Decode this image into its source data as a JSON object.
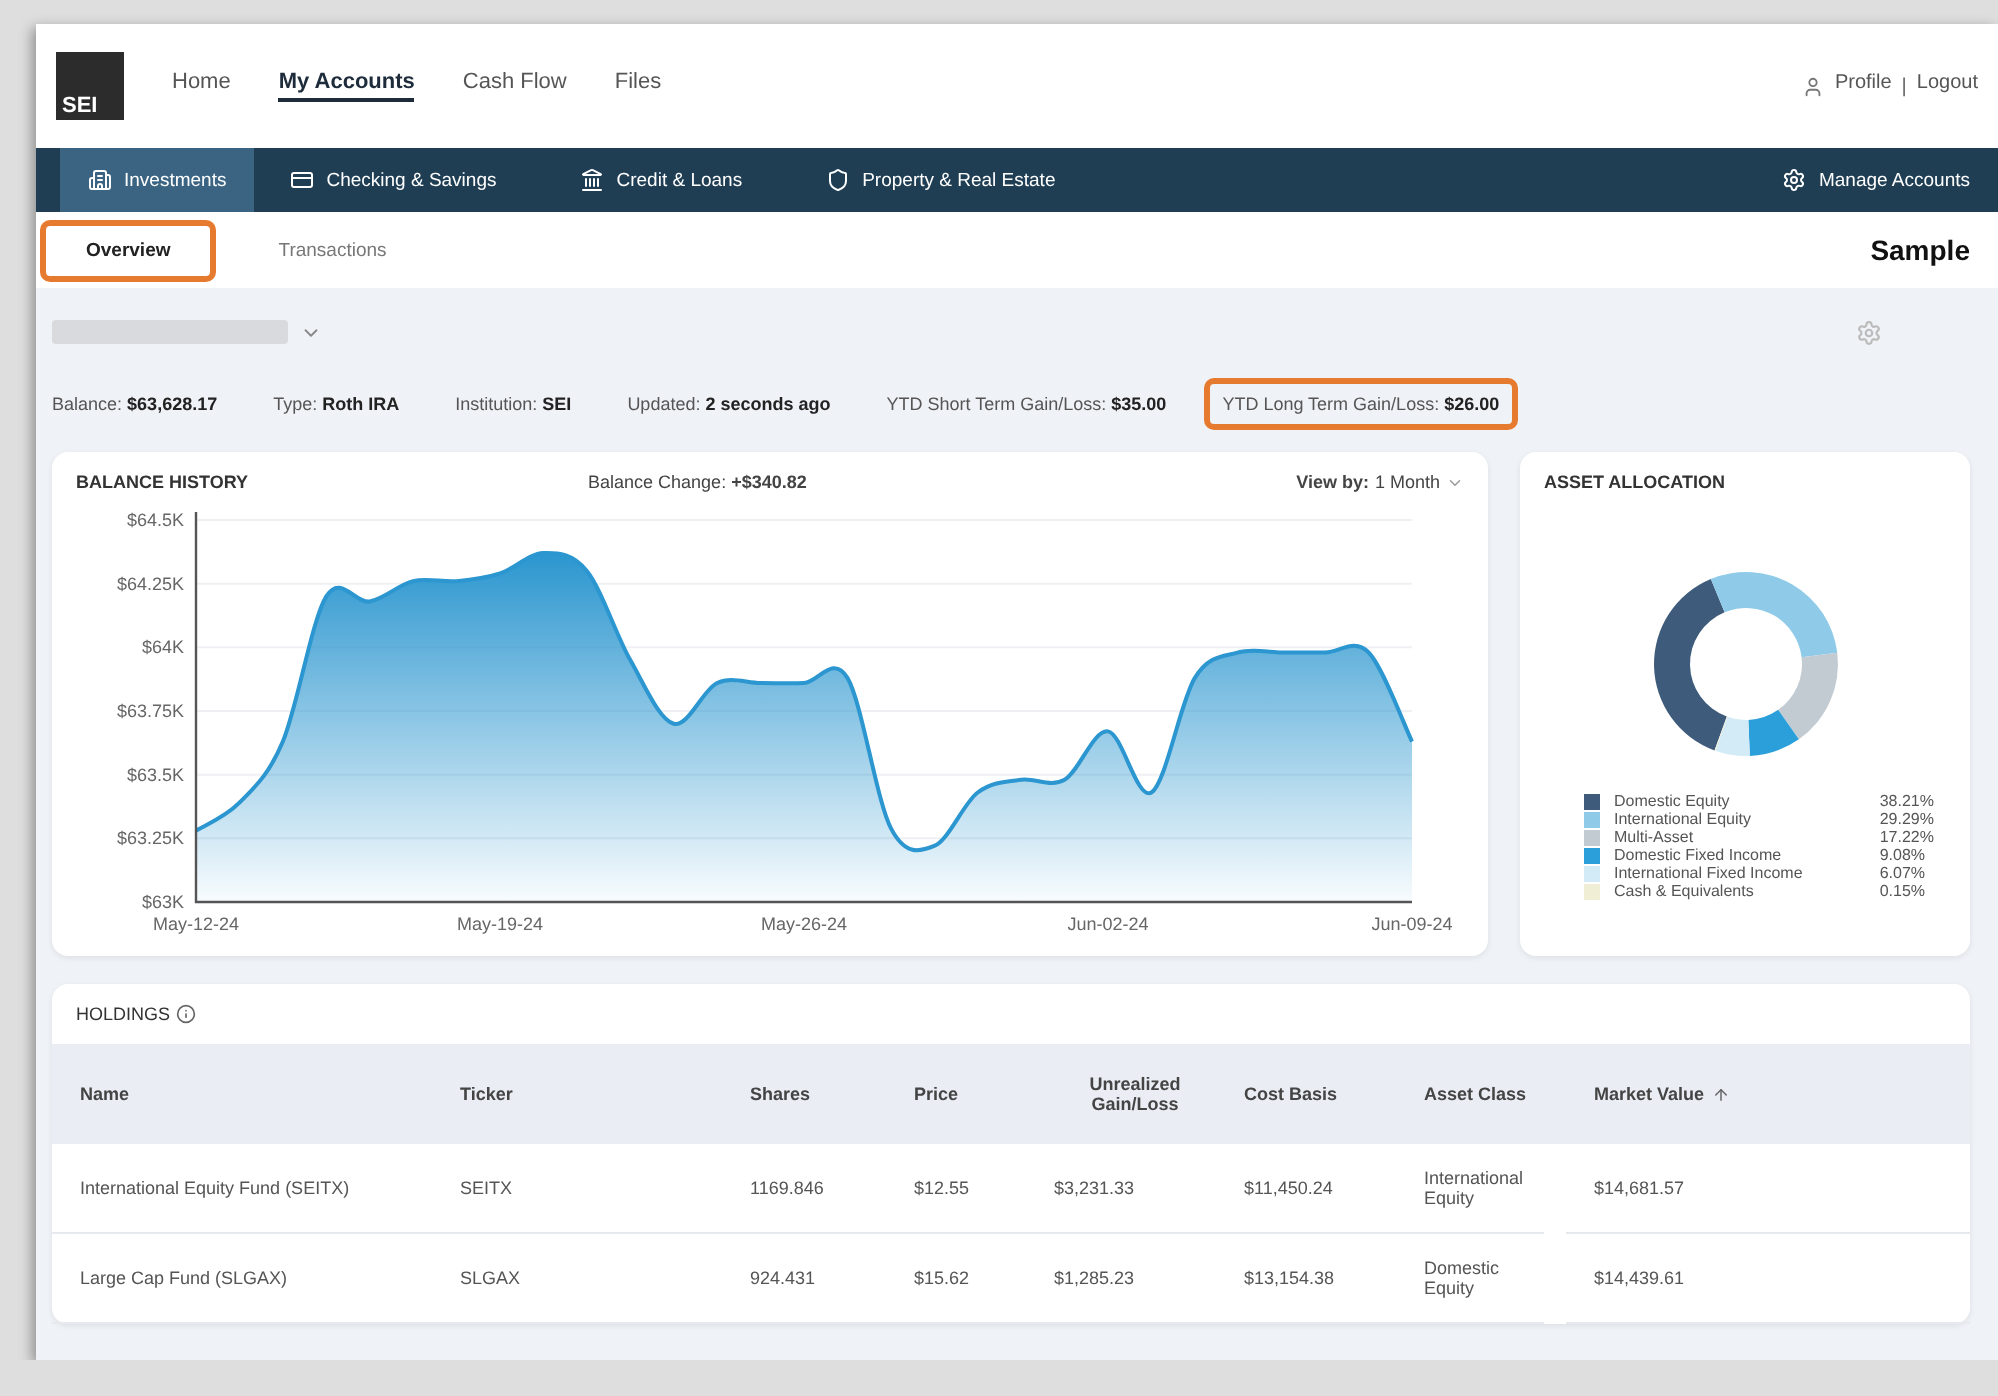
{
  "top_nav": {
    "items": [
      {
        "label": "Home",
        "selected": false
      },
      {
        "label": "My Accounts",
        "selected": true
      },
      {
        "label": "Cash Flow",
        "selected": false
      },
      {
        "label": "Files",
        "selected": false
      }
    ],
    "profile": "Profile",
    "separator": "|",
    "logout": "Logout",
    "logo": "SEI"
  },
  "category_bar": {
    "items": [
      {
        "label": "Investments",
        "kind": "investments",
        "selected": true
      },
      {
        "label": "Checking & Savings",
        "kind": "card",
        "selected": false
      },
      {
        "label": "Credit & Loans",
        "kind": "bank",
        "selected": false
      },
      {
        "label": "Property & Real Estate",
        "kind": "shield",
        "selected": false
      }
    ],
    "manage": "Manage Accounts"
  },
  "sub_tabs": [
    {
      "label": "Overview",
      "selected": true,
      "highlighted": true
    },
    {
      "label": "Transactions",
      "selected": false,
      "highlighted": false
    }
  ],
  "sample_label": "Sample",
  "summary": [
    {
      "label": "Balance:",
      "value": "$63,628.17",
      "highlighted": false
    },
    {
      "label": "Type:",
      "value": "Roth IRA",
      "highlighted": false
    },
    {
      "label": "Institution:",
      "value": "SEI",
      "highlighted": false
    },
    {
      "label": "Updated:",
      "value": "2 seconds ago",
      "highlighted": false
    },
    {
      "label": "YTD Short Term Gain/Loss:",
      "value": "$35.00",
      "highlighted": false
    },
    {
      "label": "YTD Long Term Gain/Loss:",
      "value": "$26.00",
      "highlighted": true
    }
  ],
  "balance_history": {
    "change_label": "Balance Change:",
    "change_value": "+$340.82",
    "view_label": "View by:",
    "view_value": "1 Month",
    "chart_data": {
      "type": "area",
      "title": "BALANCE HISTORY",
      "grid": true,
      "categories": [
        "May-12-24",
        null,
        null,
        null,
        null,
        null,
        null,
        "May-19-24",
        null,
        null,
        null,
        null,
        null,
        null,
        "May-26-24",
        null,
        null,
        null,
        null,
        null,
        null,
        "Jun-02-24",
        null,
        null,
        null,
        null,
        null,
        null,
        "Jun-09-24"
      ],
      "values": [
        63280,
        63390,
        63630,
        64200,
        64180,
        64260,
        64260,
        64290,
        64370,
        64300,
        63950,
        63700,
        63860,
        63860,
        63860,
        63880,
        63290,
        63220,
        63430,
        63480,
        63480,
        63670,
        63430,
        63880,
        63980,
        63980,
        63980,
        63980,
        63630
      ],
      "ylim": [
        63000,
        64500
      ],
      "yticks": [
        {
          "value": 63000,
          "label": "$63K"
        },
        {
          "value": 63250,
          "label": "$63.25K"
        },
        {
          "value": 63500,
          "label": "$63.5K"
        },
        {
          "value": 63750,
          "label": "$63.75K"
        },
        {
          "value": 64000,
          "label": "$64K"
        },
        {
          "value": 64250,
          "label": "$64.25K"
        },
        {
          "value": 64500,
          "label": "$64.5K"
        }
      ]
    }
  },
  "asset_allocation": {
    "chart_data": {
      "type": "donut",
      "title": "ASSET ALLOCATION",
      "categories": [
        "Domestic Equity",
        "International Equity",
        "Multi-Asset",
        "Domestic Fixed Income",
        "International Fixed Income",
        "Cash & Equivalents"
      ],
      "values": [
        38.21,
        29.29,
        17.22,
        9.08,
        6.07,
        0.15
      ]
    },
    "legend": [
      {
        "value": "38.21%",
        "color": "#3e5b7c"
      },
      {
        "value": "29.29%",
        "color": "#8fcbe9"
      },
      {
        "value": "17.22%",
        "color": "#c3cbd2"
      },
      {
        "value": "9.08%",
        "color": "#2b9fd9"
      },
      {
        "value": "6.07%",
        "color": "#d3ebf7"
      },
      {
        "value": "0.15%",
        "color": "#f0efd6"
      }
    ]
  },
  "holdings": {
    "title": "HOLDINGS",
    "columns": [
      {
        "label": "Name",
        "sorted": false
      },
      {
        "label": "Ticker",
        "sorted": false
      },
      {
        "label": "Shares",
        "sorted": false
      },
      {
        "label": "Price",
        "sorted": false
      },
      {
        "label": "Unrealized Gain/Loss",
        "sorted": false
      },
      {
        "label": "Cost Basis",
        "sorted": false
      },
      {
        "label": "Asset Class",
        "sorted": false
      },
      {
        "label": "Market Value",
        "sorted": true
      }
    ],
    "rows": [
      [
        "International Equity Fund (SEITX)",
        "SEITX",
        "1169.846",
        "$12.55",
        "$3,231.33",
        "$11,450.24",
        "International Equity",
        "$14,681.57"
      ],
      [
        "Large Cap Fund (SLGAX)",
        "SLGAX",
        "924.431",
        "$15.62",
        "$1,285.23",
        "$13,154.38",
        "Domestic Equity",
        "$14,439.61"
      ]
    ]
  }
}
